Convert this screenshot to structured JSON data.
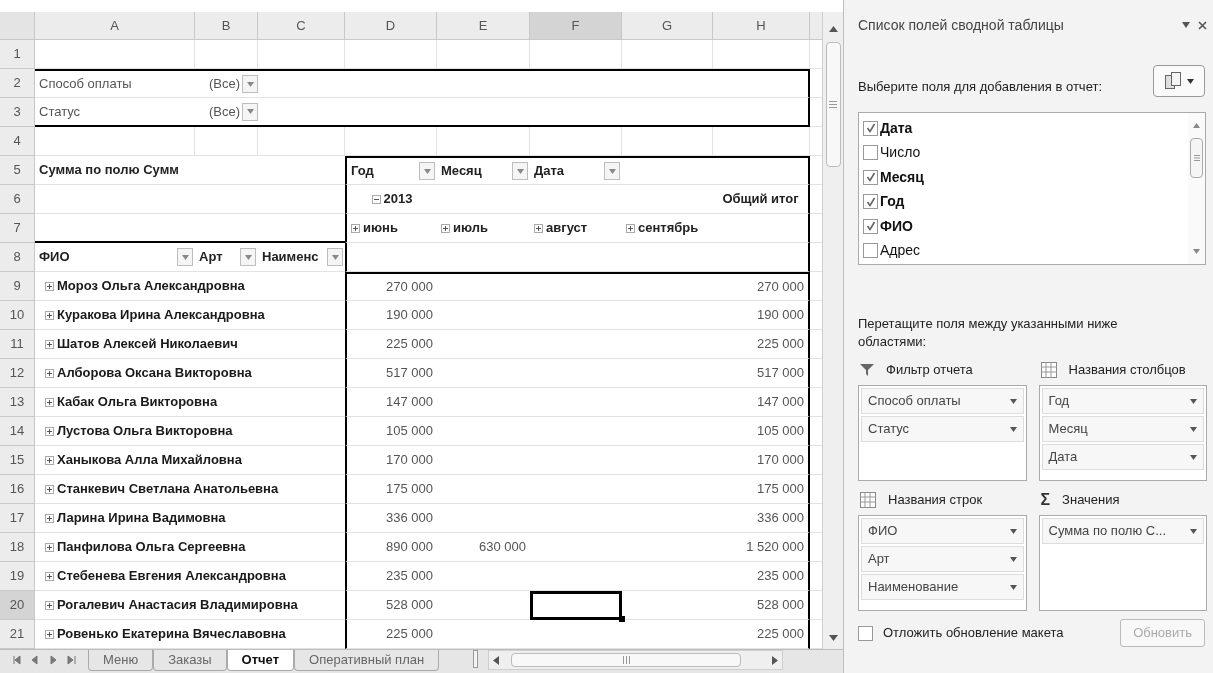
{
  "column_headers": [
    {
      "label": "A",
      "selected": false
    },
    {
      "label": "B",
      "selected": false
    },
    {
      "label": "C",
      "selected": false
    },
    {
      "label": "D",
      "selected": false
    },
    {
      "label": "E",
      "selected": false
    },
    {
      "label": "F",
      "selected": true
    },
    {
      "label": "G",
      "selected": false
    },
    {
      "label": "H",
      "selected": false
    }
  ],
  "row_numbers": [
    "1",
    "2",
    "3",
    "4",
    "5",
    "6",
    "7",
    "8",
    "9",
    "10",
    "11",
    "12",
    "13",
    "14",
    "15",
    "16",
    "17",
    "18",
    "19",
    "20",
    "21"
  ],
  "report_filters": [
    {
      "label": "Способ оплаты",
      "value": "(Все)"
    },
    {
      "label": "Статус",
      "value": "(Все)"
    }
  ],
  "pivot": {
    "values_label": "Сумма по полю Сумм",
    "column_fields": [
      "Год",
      "Месяц",
      "Дата"
    ],
    "year": {
      "label": "2013",
      "expanded": true
    },
    "months": [
      {
        "label": "июнь",
        "expanded": false
      },
      {
        "label": "июль",
        "expanded": false
      },
      {
        "label": "август",
        "expanded": false
      },
      {
        "label": "сентябрь",
        "expanded": false
      }
    ],
    "grand_total_label": "Общий итог",
    "row_fields": [
      "ФИО",
      "Арт",
      "Наименс"
    ],
    "rows": [
      {
        "name": "Мороз Ольга Александровна",
        "expanded": false,
        "june": "270 000",
        "total": "270 000",
        "selected": false
      },
      {
        "name": "Куракова Ирина Александровна",
        "expanded": false,
        "june": "190 000",
        "total": "190 000",
        "selected": false
      },
      {
        "name": "Шатов Алексей Николаевич",
        "expanded": false,
        "june": "225 000",
        "total": "225 000",
        "selected": false
      },
      {
        "name": "Алборова Оксана Викторовна",
        "expanded": false,
        "june": "517 000",
        "total": "517 000",
        "selected": false
      },
      {
        "name": "Кабак Ольга Викторовна",
        "expanded": false,
        "june": "147 000",
        "total": "147 000",
        "selected": false
      },
      {
        "name": "Лустова Ольга Викторовна",
        "expanded": false,
        "june": "105 000",
        "total": "105 000",
        "selected": false
      },
      {
        "name": "Ханыкова Алла Михайловна",
        "expanded": false,
        "june": "170 000",
        "total": "170 000",
        "selected": false
      },
      {
        "name": "Станкевич Светлана Анатольевна",
        "expanded": false,
        "june": "175 000",
        "total": "175 000",
        "selected": false
      },
      {
        "name": "Ларина Ирина Вадимовна",
        "expanded": false,
        "june": "336 000",
        "total": "336 000",
        "selected": false
      },
      {
        "name": "Панфилова Ольга Сергеевна",
        "expanded": false,
        "june": "890 000",
        "july": "630 000",
        "total": "1 520 000",
        "selected": false
      },
      {
        "name": "Стебенева Евгения Александровна",
        "expanded": false,
        "june": "235 000",
        "total": "235 000",
        "selected": false
      },
      {
        "name": "Рогалевич Анастасия Владимировна",
        "expanded": false,
        "june": "528 000",
        "total": "528 000",
        "selected": true
      },
      {
        "name": "Ровенько Екатерина Вячеславовна",
        "expanded": false,
        "june": "225 000",
        "total": "225 000",
        "selected": false
      }
    ]
  },
  "sheet_tabs": [
    {
      "label": "Меню",
      "selected": false
    },
    {
      "label": "Заказы",
      "selected": false
    },
    {
      "label": "Отчет",
      "selected": true
    },
    {
      "label": "Оперативный план",
      "selected": false
    }
  ],
  "field_list": {
    "title": "Список полей сводной таблицы",
    "prompt": "Выберите поля для добавления в отчет:",
    "fields": [
      {
        "label": "Дата",
        "checked": true
      },
      {
        "label": "Число",
        "checked": false
      },
      {
        "label": "Месяц",
        "checked": true
      },
      {
        "label": "Год",
        "checked": true
      },
      {
        "label": "ФИО",
        "checked": true
      },
      {
        "label": "Адрес",
        "checked": false
      }
    ],
    "instruction": "Перетащите поля между указанными ниже областями:",
    "areas": [
      {
        "kind": "filter",
        "title": "Фильтр отчета",
        "items": [
          "Способ оплаты",
          "Статус"
        ]
      },
      {
        "kind": "columns",
        "title": "Названия столбцов",
        "items": [
          "Год",
          "Месяц",
          "Дата"
        ]
      },
      {
        "kind": "rows",
        "title": "Названия строк",
        "items": [
          "ФИО",
          "Арт",
          "Наименование"
        ]
      },
      {
        "kind": "values",
        "title": "Значения",
        "symbol": "Σ",
        "items": [
          "Сумма по полю С..."
        ]
      }
    ],
    "defer_update": {
      "label": "Отложить обновление макета",
      "checked": false
    },
    "update_button": {
      "label": "Обновить",
      "disabled": true
    }
  }
}
